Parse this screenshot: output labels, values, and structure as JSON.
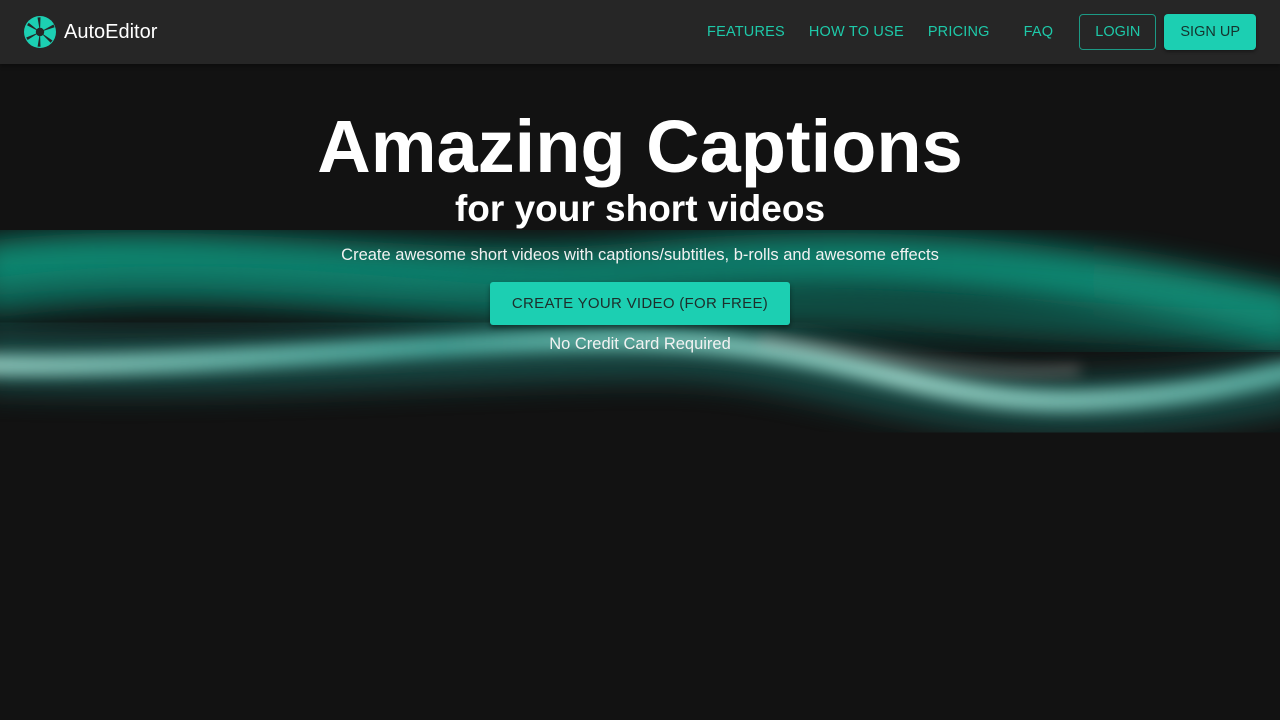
{
  "brand": {
    "name": "AutoEditor",
    "logo_icon": "aperture-icon",
    "color": "#1ccfb2"
  },
  "nav": {
    "links": [
      "FEATURES",
      "HOW TO USE",
      "PRICING",
      "FAQ"
    ],
    "login_label": "LOGIN",
    "signup_label": "SIGN UP"
  },
  "hero": {
    "title": "Amazing Captions",
    "subtitle": "for your short videos",
    "description": "Create awesome short videos with captions/subtitles, b-rolls and awesome effects",
    "cta_label": "CREATE YOUR VIDEO (FOR FREE)",
    "note": "No Credit Card Required"
  },
  "colors": {
    "accent": "#1ccfb2",
    "header_bg": "#262626",
    "page_bg": "#121212"
  }
}
